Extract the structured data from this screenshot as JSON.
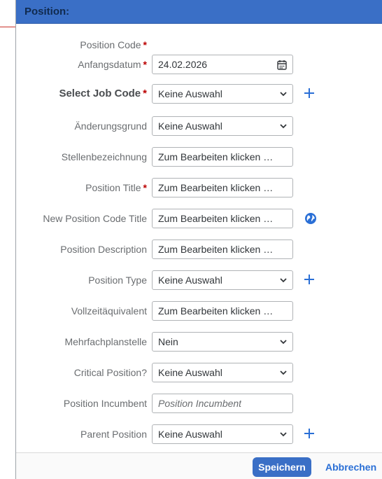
{
  "dialog": {
    "title": "Position:"
  },
  "fields": {
    "position_code": {
      "label": "Position Code",
      "required": "*"
    },
    "anfangsdatum": {
      "label": "Anfangsdatum",
      "required": "*",
      "value": "24.02.2026"
    },
    "select_job_code": {
      "label": "Select Job Code",
      "required": "*",
      "value": "Keine Auswahl"
    },
    "aenderungsgrund": {
      "label": "Änderungsgrund",
      "value": "Keine Auswahl"
    },
    "stellenbezeichnung": {
      "label": "Stellenbezeichnung",
      "value": "Zum Bearbeiten klicken ode..."
    },
    "position_title": {
      "label": "Position Title",
      "required": "*",
      "value": "Zum Bearbeiten klicken ode..."
    },
    "new_position_code_title": {
      "label": "New Position Code Title",
      "value": "Zum Bearbeiten klicken ode..."
    },
    "position_description": {
      "label": "Position Description",
      "value": "Zum Bearbeiten klicken ode..."
    },
    "position_type": {
      "label": "Position Type",
      "value": "Keine Auswahl"
    },
    "vollzeitaequivalent": {
      "label": "Vollzeitäquivalent",
      "value": "Zum Bearbeiten klicken ode..."
    },
    "mehrfachplanstelle": {
      "label": "Mehrfachplanstelle",
      "value": "Nein"
    },
    "critical_position": {
      "label": "Critical Position?",
      "value": "Keine Auswahl"
    },
    "position_incumbent": {
      "label": "Position Incumbent",
      "placeholder": "Position Incumbent"
    },
    "parent_position": {
      "label": "Parent Position",
      "value": "Keine Auswahl"
    }
  },
  "footer": {
    "save_label": "Speichern",
    "cancel_label": "Abbrechen"
  },
  "colors": {
    "header_bg": "#3a6fc6",
    "accent": "#2a6fd6",
    "required": "#bb0000"
  },
  "icons": {
    "calendar": "calendar-icon",
    "chevron": "chevron-down-icon",
    "add": "plus-icon",
    "translate": "globe-icon"
  }
}
